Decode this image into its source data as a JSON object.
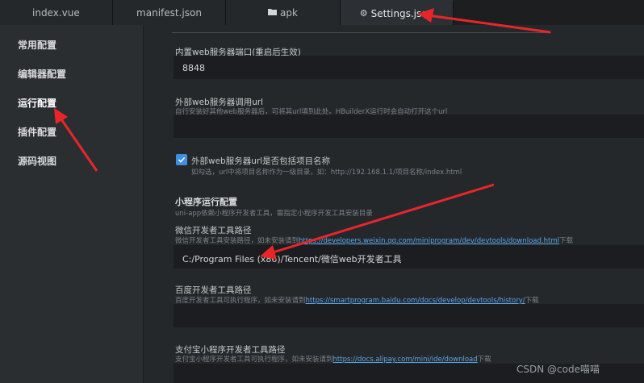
{
  "tabs": [
    {
      "label": "index.vue",
      "icon": ""
    },
    {
      "label": "manifest.json",
      "icon": ""
    },
    {
      "label": "apk",
      "icon": "folder-icon"
    },
    {
      "label": "Settings.json",
      "icon": "gear-icon"
    }
  ],
  "sidebar": {
    "items": [
      {
        "label": "常用配置"
      },
      {
        "label": "编辑器配置"
      },
      {
        "label": "运行配置"
      },
      {
        "label": "插件配置"
      },
      {
        "label": "源码视图"
      }
    ]
  },
  "settings": {
    "port": {
      "label": "内置web服务器端口(重启后生效)",
      "value": "8848"
    },
    "external_url": {
      "label": "外部web服务器调用url",
      "desc": "自行安装好其他web服务器后，可将其url填到此处。HBuilderX运行时会自动打开这个url",
      "value": ""
    },
    "include_project_name": {
      "label": "外部web服务器url是否包括项目名称",
      "desc": "如勾选，url中将项目名称作为一级目录，如：http://192.168.1.1/项目名称/index.html",
      "checked": true
    },
    "miniprogram": {
      "title": "小程序运行配置",
      "desc": "uni-app依赖小程序开发者工具，需指定小程序开发工具安装目录"
    },
    "weixin": {
      "label": "微信开发者工具路径",
      "desc_prefix": "微信开发者工具安装路径，如未安装请到",
      "link": "https://developers.weixin.qq.com/miniprogram/dev/devtools/download.html",
      "desc_suffix": "下载",
      "value": "C:/Program Files (x86)/Tencent/微信web开发者工具"
    },
    "baidu": {
      "label": "百度开发者工具路径",
      "desc_prefix": "百度开发者工具可执行程序，如未安装请到",
      "link": "https://smartprogram.baidu.com/docs/develop/devtools/history/",
      "desc_suffix": "下载",
      "value": ""
    },
    "alipay": {
      "label": "支付宝小程序开发者工具路径",
      "desc_prefix": "支付宝小程序开发者工具可执行程序，如未安装请到",
      "link": "https://docs.alipay.com/mini/ide/download",
      "desc_suffix": "下载",
      "value": ""
    }
  },
  "watermark": "CSDN @code喵喵",
  "colors": {
    "accent": "#3d8fe0",
    "link": "#5aa6e8",
    "annotation_arrow": "#e8262a"
  }
}
